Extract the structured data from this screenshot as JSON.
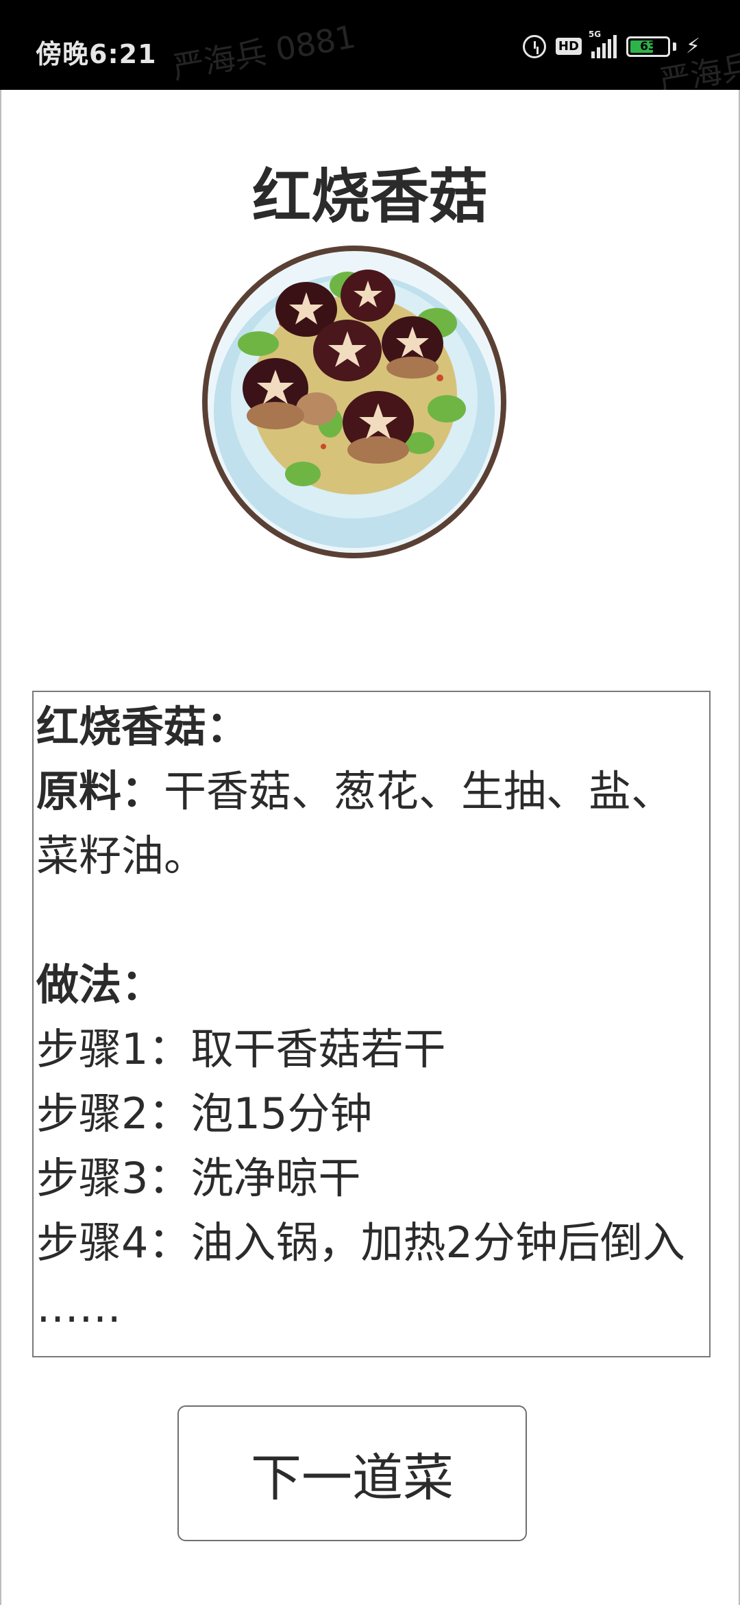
{
  "status_bar": {
    "time": "傍晚6:21",
    "watermark": "严海兵 0881",
    "network": "HD",
    "network_gen": "5G",
    "battery_level": "63",
    "battery_fraction": 0.63,
    "icons": [
      "alarm-icon",
      "hd-icon",
      "signal-icon",
      "battery-icon",
      "charging-bolt-icon"
    ]
  },
  "page": {
    "title": "红烧香菇"
  },
  "recipe": {
    "heading": "红烧香菇：",
    "ingredients_label": "原料：",
    "ingredients_line1": "干香菇、葱花、生抽、盐、",
    "ingredients_line2": "菜籽油。",
    "method_label": "做法：",
    "steps": [
      "步骤1：取干香菇若干",
      "步骤2：泡15分钟",
      "步骤3：洗净晾干",
      "步骤4：油入锅，加热2分钟后倒入"
    ],
    "ellipsis": "……"
  },
  "button": {
    "next_label": "下一道菜"
  },
  "colors": {
    "status_bar_bg": "#000000",
    "battery_green": "#2db34a",
    "plate_blue": "#bfe0ec"
  }
}
